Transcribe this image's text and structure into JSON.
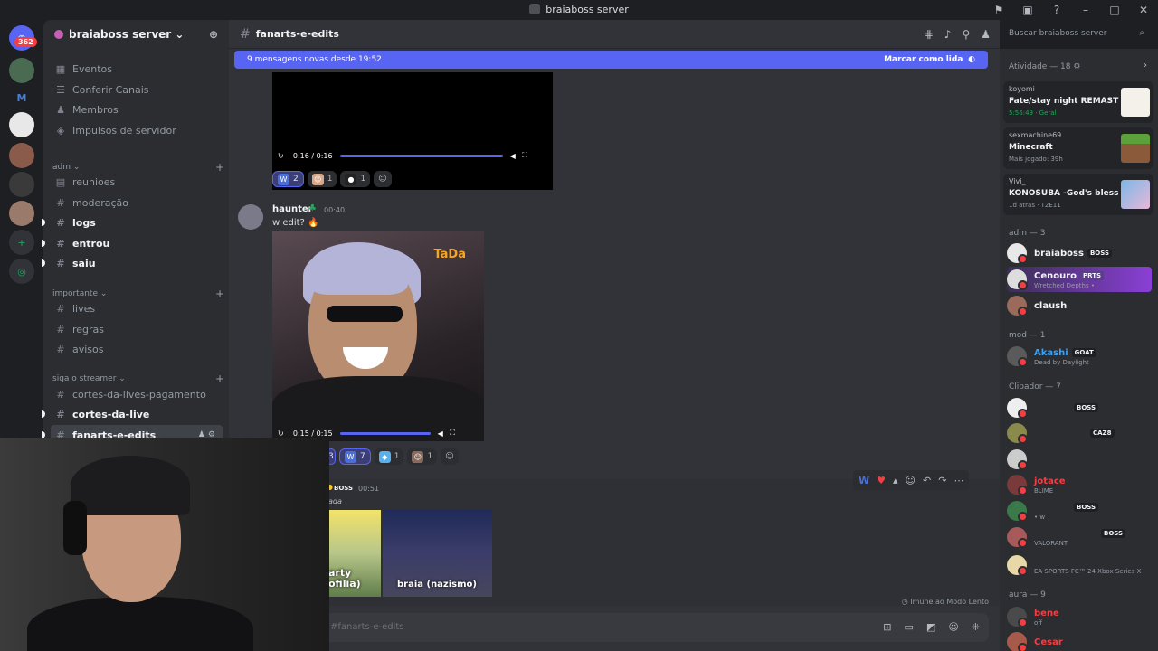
{
  "window": {
    "title": "braiaboss server"
  },
  "rail": {
    "badge": "362"
  },
  "server": {
    "name": "braiaboss server"
  },
  "sidebar": {
    "top_items": [
      {
        "label": "Eventos"
      },
      {
        "label": "Conferir Canais"
      },
      {
        "label": "Membros"
      },
      {
        "label": "Impulsos de servidor"
      }
    ],
    "categories": [
      {
        "label": "adm"
      },
      {
        "label": "importante"
      },
      {
        "label": "siga o streamer"
      }
    ],
    "channels": [
      {
        "label": "reunioes"
      },
      {
        "label": "moderação"
      },
      {
        "label": "logs"
      },
      {
        "label": "entrou"
      },
      {
        "label": "saiu"
      },
      {
        "label": "lives"
      },
      {
        "label": "regras"
      },
      {
        "label": "avisos"
      },
      {
        "label": "cortes-da-lives-pagamento"
      },
      {
        "label": "cortes-da-live"
      },
      {
        "label": "fanarts-e-edits"
      }
    ]
  },
  "header": {
    "channel": "fanarts-e-edits",
    "search_placeholder": "Buscar braiaboss server"
  },
  "chat": {
    "new_messages": "9 mensagens novas desde 19:52",
    "mark_read": "Marcar como lida",
    "video1": {
      "time": "0:16 / 0:16",
      "progress": 1.0
    },
    "reactions1": [
      {
        "emoji": "W",
        "count": "2"
      },
      {
        "emoji": "☺",
        "count": "1"
      },
      {
        "emoji": "●",
        "count": "1"
      }
    ],
    "msg2": {
      "author": "haunter",
      "time": "00:40",
      "text": "w edit? 🔥"
    },
    "video2": {
      "overlay": "TaDa",
      "time": "0:15 / 0:15",
      "progress": 1.0
    },
    "reactions2": [
      {
        "emoji": "W",
        "count": "7"
      },
      {
        "emoji": "◆",
        "count": "1"
      },
      {
        "emoji": "☺",
        "count": "1"
      }
    ],
    "reactions2_partial": "3",
    "msg3": {
      "tag": "BOSS",
      "time": "00:51",
      "partial_text": "ada"
    },
    "images": [
      {
        "caption": "arty\nofilia)"
      },
      {
        "caption": "braia (nazismo)"
      }
    ],
    "immune": "Imune ao Modo Lento",
    "composer_placeholder": "#fanarts-e-edits"
  },
  "members": {
    "activity_header": "Atividade — 18",
    "activities": [
      {
        "user": "koyomi",
        "game": "Fate/stay night REMASTE...",
        "status": "5:56:49 · Geral"
      },
      {
        "user": "sexmachine69",
        "game": "Minecraft",
        "status": "Mais jogado: 39h"
      },
      {
        "user": "Vivi_",
        "game": "KONOSUBA -God's blessin...",
        "status": "1d atrás · T2E11"
      }
    ],
    "groups": [
      {
        "label": "adm — 3"
      },
      {
        "label": "mod — 1"
      },
      {
        "label": "Clipador — 7"
      },
      {
        "label": "aura — 9"
      }
    ],
    "adm": [
      {
        "name": "braiaboss",
        "tag": "BOSS",
        "sub": ""
      },
      {
        "name": "Cenouro",
        "tag": "PRTS",
        "sub": "Wretched Depths •"
      },
      {
        "name": "claush",
        "tag": "",
        "sub": ""
      }
    ],
    "mod": [
      {
        "name": "Akashi",
        "tag": "GOAT",
        "sub": "Dead by Daylight"
      }
    ],
    "clipador": [
      {
        "name": "",
        "tag": "BOSS",
        "sub": ""
      },
      {
        "name": "",
        "tag": "CAZ8",
        "sub": ""
      },
      {
        "name": "",
        "tag": "",
        "sub": ""
      },
      {
        "name": "jotace",
        "tag": "",
        "sub": "BLIME"
      },
      {
        "name": "",
        "tag": "BOSS",
        "sub": "• w"
      },
      {
        "name": "",
        "tag": "BOSS",
        "sub": "VALORANT"
      },
      {
        "name": "",
        "tag": "",
        "sub": "EA SPORTS FC™ 24 Xbox Series X"
      }
    ],
    "aura": [
      {
        "name": "bene",
        "sub": "off"
      },
      {
        "name": "Cesar",
        "sub": ""
      }
    ]
  },
  "colors": {
    "accent": "#5865f2",
    "bg_main": "#313338",
    "bg_side": "#2b2d31",
    "danger": "#f23f43"
  }
}
